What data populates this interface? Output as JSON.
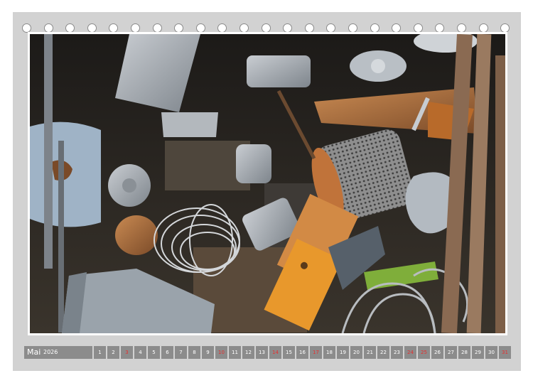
{
  "calendar": {
    "month": "Mai",
    "year": "2026",
    "days": [
      {
        "n": "1",
        "sunday": false
      },
      {
        "n": "2",
        "sunday": false
      },
      {
        "n": "3",
        "sunday": true
      },
      {
        "n": "4",
        "sunday": false
      },
      {
        "n": "5",
        "sunday": false
      },
      {
        "n": "6",
        "sunday": false
      },
      {
        "n": "7",
        "sunday": false
      },
      {
        "n": "8",
        "sunday": false
      },
      {
        "n": "9",
        "sunday": false
      },
      {
        "n": "10",
        "sunday": true
      },
      {
        "n": "11",
        "sunday": false
      },
      {
        "n": "12",
        "sunday": false
      },
      {
        "n": "13",
        "sunday": false
      },
      {
        "n": "14",
        "sunday": true
      },
      {
        "n": "15",
        "sunday": false
      },
      {
        "n": "16",
        "sunday": false
      },
      {
        "n": "17",
        "sunday": true
      },
      {
        "n": "18",
        "sunday": false
      },
      {
        "n": "19",
        "sunday": false
      },
      {
        "n": "20",
        "sunday": false
      },
      {
        "n": "21",
        "sunday": false
      },
      {
        "n": "22",
        "sunday": false
      },
      {
        "n": "23",
        "sunday": false
      },
      {
        "n": "24",
        "sunday": true
      },
      {
        "n": "25",
        "sunday": true
      },
      {
        "n": "26",
        "sunday": false
      },
      {
        "n": "27",
        "sunday": false
      },
      {
        "n": "28",
        "sunday": false
      },
      {
        "n": "29",
        "sunday": false
      },
      {
        "n": "30",
        "sunday": false
      },
      {
        "n": "31",
        "sunday": true
      }
    ]
  },
  "photo": {
    "subject": "scrap-metal-pile"
  },
  "colors": {
    "frame": "#d2d2d2",
    "bar": "#8c8c8c",
    "sunday_text": "#e53030",
    "weekday_text": "#ffffff"
  }
}
